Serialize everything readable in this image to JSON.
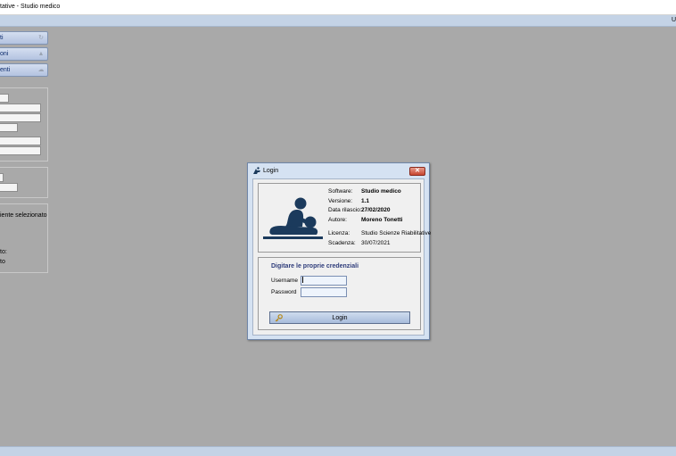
{
  "window": {
    "title": "tative - Studio medico"
  },
  "menubar": {
    "right_text": "U"
  },
  "sidebar": {
    "nav": [
      {
        "label": "ti",
        "icon": "refresh-icon"
      },
      {
        "label": "oni",
        "icon": "bell-icon"
      },
      {
        "label": "enti",
        "icon": "cloud-icon"
      }
    ],
    "patient_text": "iente selezionato",
    "text_1": "to:",
    "text_2": "to"
  },
  "login": {
    "title": "Login",
    "close_label": "✕",
    "info": {
      "software_label": "Software:",
      "software_value": "Studio medico",
      "version_label": "Versione:",
      "version_value": "1.1",
      "release_label": "Data rilascio:",
      "release_value": "27/02/2020",
      "author_label": "Autore:",
      "author_value": "Moreno Tonetti",
      "license_label": "Licenza:",
      "license_value": "Studio Scienze Riabilitative",
      "expiry_label": "Scadenza:",
      "expiry_value": "30/07/2021"
    },
    "credentials": {
      "heading": "Digitare le proprie credenziali",
      "username_label": "Username",
      "username_value": "",
      "password_label": "Password",
      "password_value": "",
      "button_label": "Login"
    }
  },
  "colors": {
    "background": "#a9a9a9",
    "bar_blue": "#c4d3e6",
    "heading_blue": "#2e3c7a",
    "icon_navy": "#1b3a5c",
    "close_red": "#c7452f"
  }
}
